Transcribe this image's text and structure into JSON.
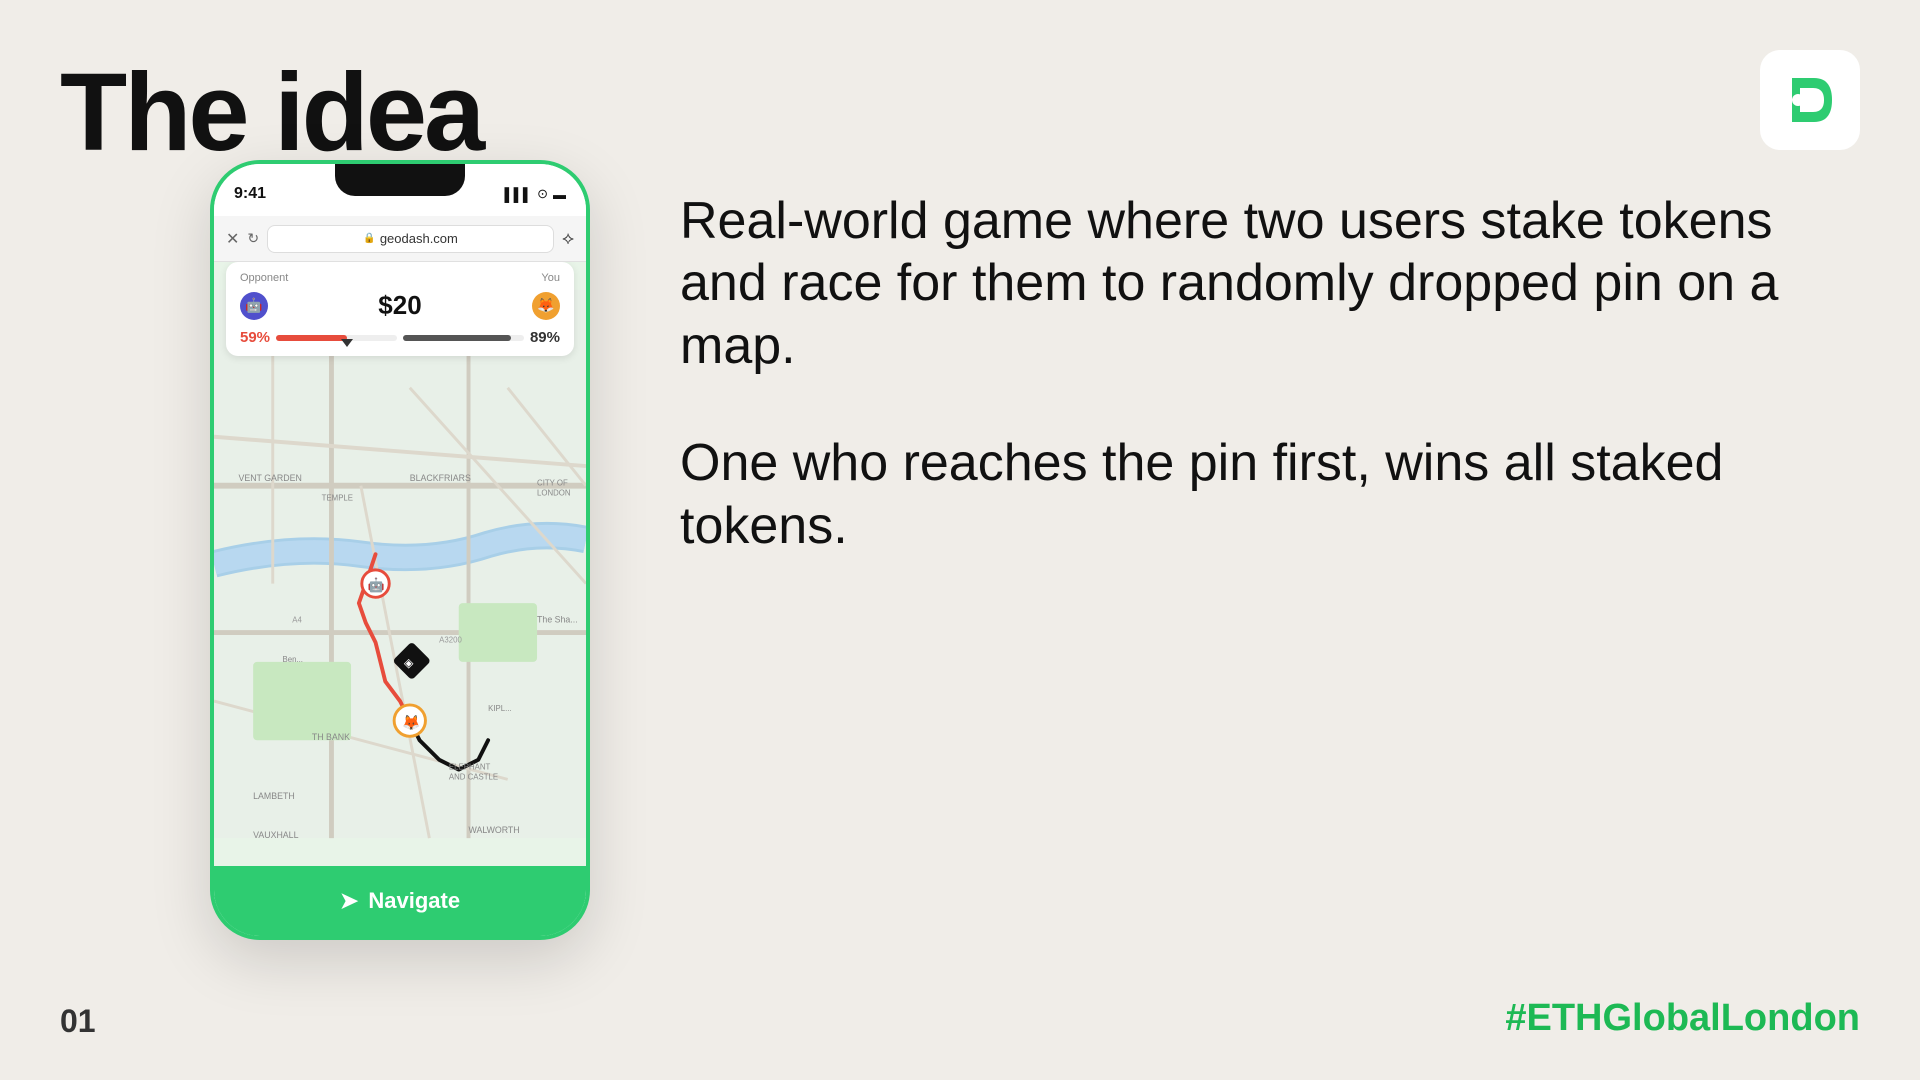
{
  "title": "The idea",
  "slide_number": "01",
  "hashtag": "#ETHGlobalLondon",
  "logo": {
    "alt": "GeoDash logo"
  },
  "phone": {
    "status_time": "9:41",
    "status_signal": "▌▌▌",
    "status_wifi": "📶",
    "status_battery": "🔋",
    "browser_url": "geodash.com",
    "game": {
      "opponent_label": "Opponent",
      "you_label": "You",
      "opponent_pct": "59%",
      "stake": "$20",
      "you_pct": "89%"
    },
    "navigate_btn": "Navigate"
  },
  "description": {
    "para1": "Real-world game where two users stake tokens and race for them to randomly dropped pin on a map.",
    "para2": "One who reaches the pin first, wins all staked tokens."
  }
}
